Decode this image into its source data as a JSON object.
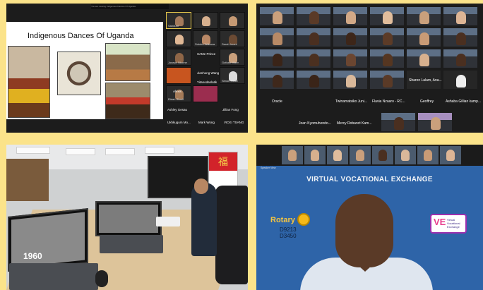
{
  "panels": {
    "zoom_slideshare": {
      "slide_title": "Indigenous Dances Of Uganda",
      "top_notice": "You are viewing Indigenous Dances Of Uganda",
      "tiles": [
        {
          "label": "Sanduni"
        },
        {
          "label": ""
        },
        {
          "label": ""
        },
        {
          "label": ""
        },
        {
          "label": "Sotoko Wakana"
        },
        {
          "label": "Sarah Imani"
        },
        {
          "label": "Joseph Nkorne"
        },
        {
          "label": "Gothan Mizer"
        },
        {
          "label": ""
        },
        {
          "label": "Simon Masiv"
        },
        {
          "label": "Ridah Sharif"
        },
        {
          "label": ""
        }
      ],
      "big_labels": [
        "SAMe Prince",
        "Jianhong Wang",
        "Yitanodanlatik",
        "Alexis",
        "Jillian Fong",
        "Ashley Gesau",
        "Mark Wong",
        "VICKI TSANG",
        "Ukhkugum Mo..."
      ]
    },
    "zoom_gallery": {
      "participants": [
        {
          "name": "Sharon Lalam, Ana..."
        },
        {
          "name": "Oracle"
        },
        {
          "name": "Twinamatsiko Juni..."
        },
        {
          "name": "Flavia Nzaaro - RC..."
        },
        {
          "name": "Geoffrey"
        },
        {
          "name": "Ashaba Gillian kamp..."
        },
        {
          "name": "Joan Kyomuhendo..."
        },
        {
          "name": "Mercy Robanct Kam..."
        }
      ]
    },
    "office": {
      "screen_year": "1960",
      "calendar_glyph": "福"
    },
    "presenter": {
      "title": "VIRTUAL VOCATIONAL EXCHANGE",
      "rotary_word": "Rotary",
      "districts": [
        "D9213",
        "D3450"
      ],
      "vve_logo_letters": "VE",
      "vve_logo_text": "Virtual Vocational Exchange",
      "small_label": "Speaker View"
    }
  },
  "colors": {
    "frame_bg": "#fbe38a",
    "presenter_bg": "#2e64a8",
    "rotary_gold": "#f5b91a",
    "vve_pink": "#e83f8f"
  }
}
